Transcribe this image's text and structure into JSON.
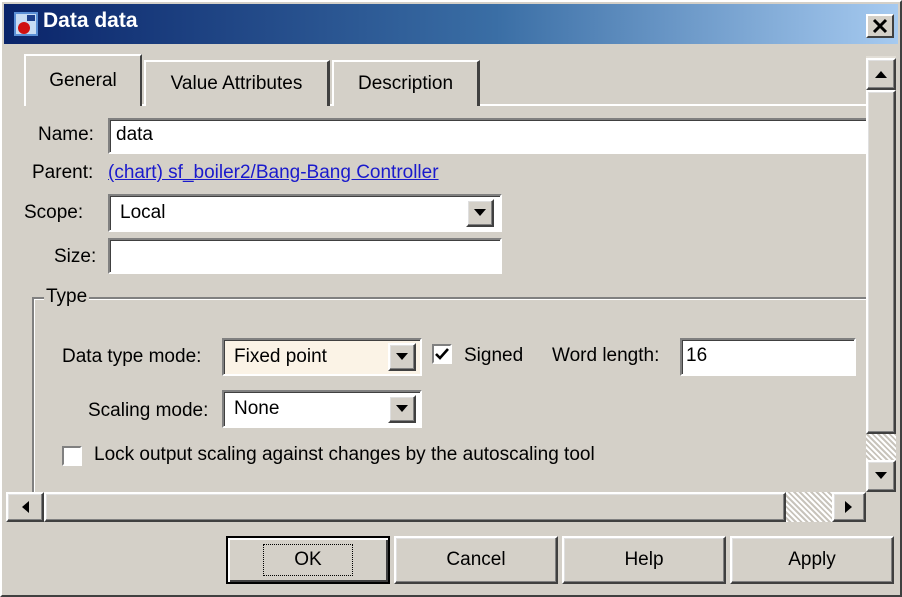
{
  "window": {
    "title": "Data data"
  },
  "tabs": [
    {
      "label": "General"
    },
    {
      "label": "Value Attributes"
    },
    {
      "label": "Description"
    }
  ],
  "general": {
    "name_label": "Name:",
    "name_value": "data",
    "parent_label": "Parent:",
    "parent_link": "(chart) sf_boiler2/Bang-Bang Controller",
    "scope_label": "Scope:",
    "scope_value": "Local",
    "size_label": "Size:",
    "size_value": ""
  },
  "type_group": {
    "legend": "Type",
    "data_type_mode_label": "Data type mode:",
    "data_type_mode_value": "Fixed point",
    "signed_label": "Signed",
    "signed_checked": true,
    "word_length_label": "Word length:",
    "word_length_value": "16",
    "scaling_mode_label": "Scaling mode:",
    "scaling_mode_value": "None",
    "lock_label": "Lock output scaling against changes by the autoscaling tool",
    "lock_checked": false
  },
  "buttons": {
    "ok": "OK",
    "cancel": "Cancel",
    "help": "Help",
    "apply": "Apply"
  },
  "icons": {
    "app": "simulink-data-icon",
    "close": "close-icon",
    "dropdown": "triangle-down-icon",
    "scroll_up": "triangle-up-icon",
    "scroll_down": "triangle-down-icon",
    "scroll_left": "triangle-left-icon",
    "scroll_right": "triangle-right-icon",
    "check": "checkmark-icon"
  },
  "colors": {
    "title_bar_start": "#0a246a",
    "title_bar_end": "#a6caf0",
    "dialog_face": "#d4d0c8",
    "link": "#1a1acc",
    "highlighted_combo": "#fbf3e6"
  }
}
